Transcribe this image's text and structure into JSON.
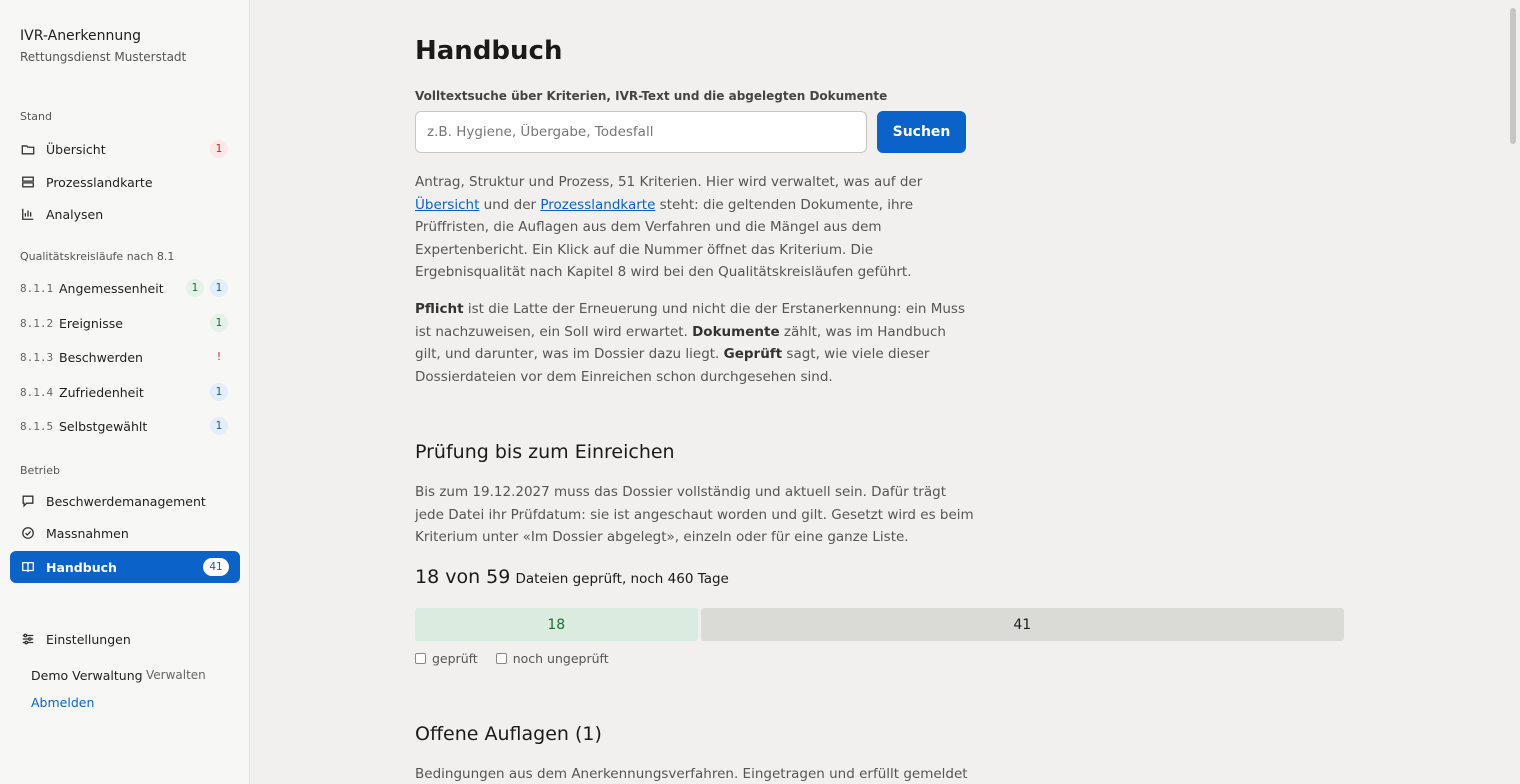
{
  "sidebar": {
    "app_title": "IVR-Anerkennung",
    "org": "Rettungsdienst Musterstadt",
    "sections": {
      "stand": "Stand",
      "qk": "Qualitätskreisläufe nach 8.1",
      "betrieb": "Betrieb"
    },
    "stand_items": [
      {
        "label": "Übersicht",
        "icon": "folder-icon",
        "badge": "1"
      },
      {
        "label": "Prozesslandkarte",
        "icon": "stack-icon"
      },
      {
        "label": "Analysen",
        "icon": "bar-chart-icon"
      }
    ],
    "qk_items": [
      {
        "num": "8.1.1",
        "label": "Angemessenheit",
        "badge_green": "1",
        "badge_blue": "1"
      },
      {
        "num": "8.1.2",
        "label": "Ereignisse",
        "badge_green": "1"
      },
      {
        "num": "8.1.3",
        "label": "Beschwerden",
        "badge_red": "!"
      },
      {
        "num": "8.1.4",
        "label": "Zufriedenheit",
        "badge_blue": "1"
      },
      {
        "num": "8.1.5",
        "label": "Selbstgewählt",
        "badge_blue": "1"
      }
    ],
    "betrieb_items": [
      {
        "label": "Beschwerdemanagement",
        "icon": "chat-icon"
      },
      {
        "label": "Massnahmen",
        "icon": "check-circle-icon"
      },
      {
        "label": "Handbuch",
        "icon": "book-icon",
        "badge": "41",
        "active": true
      }
    ],
    "settings": {
      "label": "Einstellungen",
      "icon": "sliders-icon"
    },
    "user": {
      "name": "Demo Verwaltung",
      "role": "Verwalten",
      "logout": "Abmelden"
    }
  },
  "main": {
    "title": "Handbuch",
    "search": {
      "label": "Volltextsuche über Kriterien, IVR-Text und die abgelegten Dokumente",
      "placeholder": "z.B. Hygiene, Übergabe, Todesfall",
      "button": "Suchen"
    },
    "intro": {
      "p1_a": "Antrag, Struktur und Prozess, 51 Kriterien. Hier wird verwaltet, was auf der ",
      "p1_link1": "Übersicht",
      "p1_b": " und der ",
      "p1_link2": "Prozesslandkarte",
      "p1_c": " steht: die geltenden Dokumente, ihre Prüffristen, die Auflagen aus dem Verfahren und die Mängel aus dem Expertenbericht. Ein Klick auf die Nummer öffnet das Kriterium. Die Ergebnisqualität nach Kapitel 8 wird bei den Qualitätskreisläufen geführt.",
      "p2_b1": "Pflicht",
      "p2_t1": " ist die Latte der Erneuerung und nicht die der Erstanerkennung: ein Muss ist nachzuweisen, ein Soll wird erwartet. ",
      "p2_b2": "Dokumente",
      "p2_t2": " zählt, was im Handbuch gilt, und darunter, was im Dossier dazu liegt. ",
      "p2_b3": "Geprüft",
      "p2_t3": " sagt, wie viele dieser Dossierdateien vor dem Einreichen schon durchgesehen sind."
    },
    "pruefung": {
      "heading": "Prüfung bis zum Einreichen",
      "text": "Bis zum 19.12.2027 muss das Dossier vollständig und aktuell sein. Dafür trägt jede Datei ihr Prüfdatum: sie ist angeschaut worden und gilt. Gesetzt wird es beim Kriterium unter «Im Dossier abgelegt», einzeln oder für eine ganze Liste.",
      "count_big": "18 von 59",
      "count_small": "Dateien geprüft, noch 460 Tage",
      "checked": 18,
      "unchecked": 41,
      "checked_label": "18",
      "unchecked_label": "41",
      "legend_checked": "geprüft",
      "legend_unchecked": "noch ungeprüft"
    },
    "auflagen": {
      "heading": "Offene Auflagen (1)",
      "text": "Bedingungen aus dem Anerkennungsverfahren. Eingetragen und erfüllt gemeldet"
    }
  }
}
